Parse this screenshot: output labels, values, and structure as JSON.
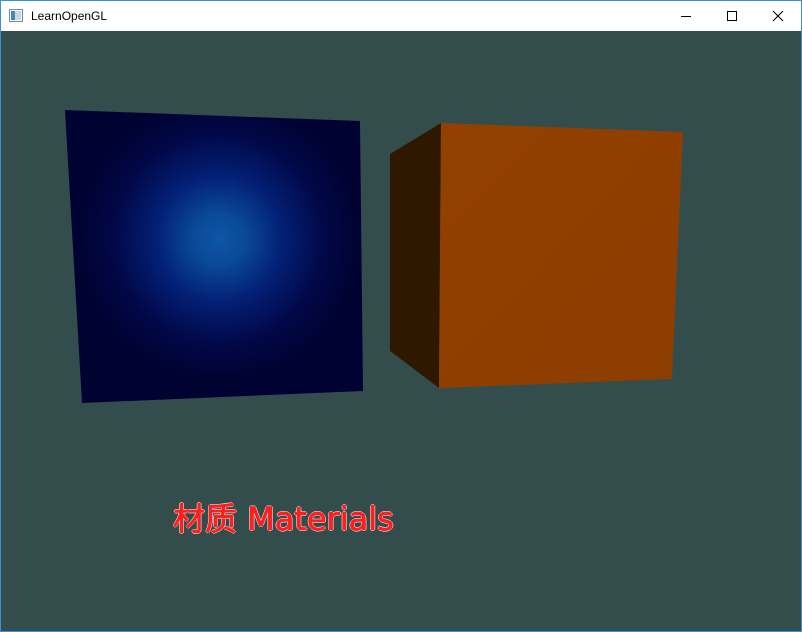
{
  "window": {
    "title": "LearnOpenGL",
    "controls": {
      "minimize": "minimize-icon",
      "maximize": "maximize-icon",
      "close": "close-icon"
    }
  },
  "viewport": {
    "clear_color": "#334d4d",
    "caption": "材质  Materials",
    "caption_color": "#ff1f1f"
  },
  "objects": [
    {
      "name": "blue-cube",
      "front_color": "#000033",
      "highlight_color": "#0a4a9a"
    },
    {
      "name": "orange-cube",
      "front_color": "#8f3f00",
      "side_color": "#2e1800"
    }
  ]
}
